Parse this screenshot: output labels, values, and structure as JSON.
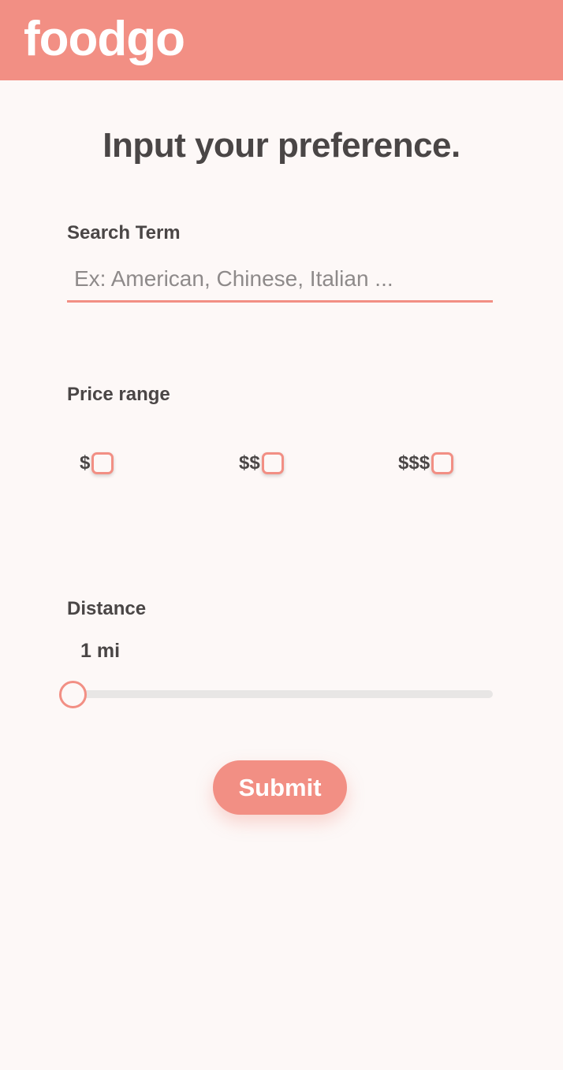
{
  "header": {
    "logo": "foodgo",
    "brand_color": "#f28f84"
  },
  "form": {
    "title": "Input your preference.",
    "search": {
      "label": "Search Term",
      "placeholder": "Ex: American, Chinese, Italian ...",
      "value": ""
    },
    "price": {
      "label": "Price range",
      "options": [
        {
          "label": "$",
          "checked": false
        },
        {
          "label": "$$",
          "checked": false
        },
        {
          "label": "$$$",
          "checked": false
        }
      ]
    },
    "distance": {
      "label": "Distance",
      "value_text": "1 mi",
      "slider_fraction": 0
    },
    "submit_label": "Submit"
  }
}
